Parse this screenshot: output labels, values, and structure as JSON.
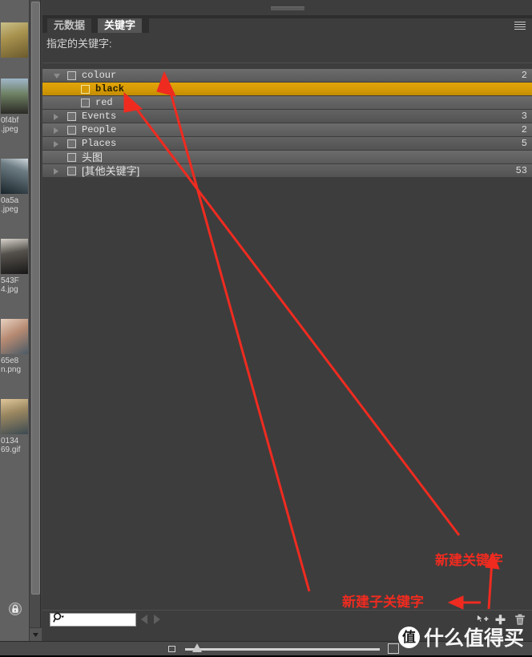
{
  "app": {
    "panel_title": "Keywords Panel",
    "panel_menu_icon": "hamburger-menu-icon"
  },
  "tabs": [
    {
      "label": "元数据",
      "active": false
    },
    {
      "label": "关键字",
      "active": true
    }
  ],
  "assigned": {
    "label": "指定的关键字:"
  },
  "keywords": [
    {
      "label": "colour",
      "count": "2",
      "depth": 0,
      "expanded": true,
      "has_children": true,
      "selected": false,
      "checked": false,
      "cjk": false
    },
    {
      "label": "black",
      "count": "",
      "depth": 1,
      "expanded": false,
      "has_children": false,
      "selected": true,
      "checked": false,
      "cjk": false
    },
    {
      "label": "red",
      "count": "",
      "depth": 1,
      "expanded": false,
      "has_children": false,
      "selected": false,
      "checked": false,
      "cjk": false
    },
    {
      "label": "Events",
      "count": "3",
      "depth": 0,
      "expanded": false,
      "has_children": true,
      "selected": false,
      "checked": false,
      "cjk": false
    },
    {
      "label": "People",
      "count": "2",
      "depth": 0,
      "expanded": false,
      "has_children": true,
      "selected": false,
      "checked": false,
      "cjk": false
    },
    {
      "label": "Places",
      "count": "5",
      "depth": 0,
      "expanded": false,
      "has_children": true,
      "selected": false,
      "checked": false,
      "cjk": false
    },
    {
      "label": "头图",
      "count": "",
      "depth": 0,
      "expanded": false,
      "has_children": false,
      "selected": false,
      "checked": false,
      "cjk": true
    },
    {
      "label": "[其他关键字]",
      "count": "53",
      "depth": 0,
      "expanded": false,
      "has_children": true,
      "selected": false,
      "checked": false,
      "cjk": true
    }
  ],
  "search": {
    "value": "",
    "placeholder": "",
    "icon": "magnifier-icon",
    "prev_icon": "prev-arrow-icon",
    "next_icon": "next-arrow-icon"
  },
  "toolbar": {
    "new_sub_keyword_icon": "new-sub-keyword-icon",
    "new_keyword_icon": "new-keyword-icon",
    "delete_keyword_icon": "trash-icon"
  },
  "annotations": [
    {
      "text": "新建关键字",
      "color": "#ef2b20"
    },
    {
      "text": "新建子关键字",
      "color": "#ef2b20"
    }
  ],
  "sidebar": {
    "lock_icon": "lock-icon",
    "scroll_down_icon": "scroll-down-arrow-icon",
    "thumbnails": [
      {
        "name_line1": "",
        "name_line2": "",
        "thumb_class": "t0"
      },
      {
        "name_line1": "0f4bf",
        "name_line2": ".jpeg",
        "thumb_class": "t1"
      },
      {
        "name_line1": "0a5a",
        "name_line2": ".jpeg",
        "thumb_class": "t2"
      },
      {
        "name_line1": "543F",
        "name_line2": "4.jpg",
        "thumb_class": "t3"
      },
      {
        "name_line1": "65e8",
        "name_line2": "n.png",
        "thumb_class": "t4"
      },
      {
        "name_line1": "0134",
        "name_line2": "69.gif",
        "thumb_class": "t5"
      }
    ]
  },
  "bottom": {
    "small_thumb_icon": "small-thumbnail-icon",
    "large_thumb_icon": "large-thumbnail-icon",
    "zoom_slider": "thumbnail-size-slider"
  },
  "watermark": {
    "logo": "值",
    "text": "什么值得买"
  },
  "colors": {
    "panel_bg": "#3d3d3d",
    "row_bg": "#636363",
    "selection": "#d69a05",
    "annotation": "#ef2b20",
    "text": "#e3e3e3"
  }
}
